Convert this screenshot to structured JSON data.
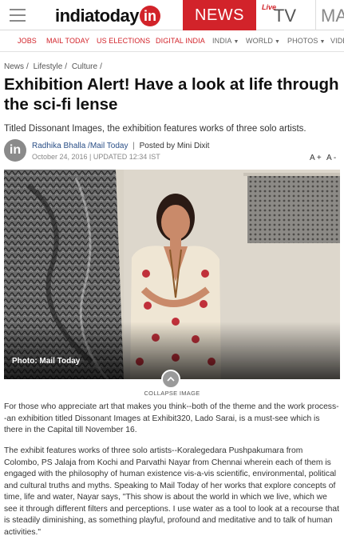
{
  "header": {
    "logo_text": "indiatoday",
    "logo_badge": "in",
    "news_tab": "NEWS",
    "tv_live": "Live",
    "tv_tab": "TV",
    "ma_tab": "MA"
  },
  "subnav": [
    {
      "label": "JOBS"
    },
    {
      "label": "MAIL TODAY"
    },
    {
      "label": "US ELECTIONS"
    },
    {
      "label": "DIGITAL INDIA"
    },
    {
      "label": "INDIA"
    },
    {
      "label": "WORLD"
    },
    {
      "label": "PHOTOS"
    },
    {
      "label": "VIDE"
    }
  ],
  "breadcrumb": [
    "News",
    "Lifestyle",
    "Culture"
  ],
  "article": {
    "headline": "Exhibition Alert! Have a look at life through the sci-fi lense",
    "subhead": "Titled Dissonant Images, the exhibition features works of three solo artists.",
    "avatar": "in",
    "author": "Radhika Bhalla",
    "outlet": "/Mail Today",
    "posted_by": "Posted by Mini Dixit",
    "date": "October 24, 2016 | UPDATED 12:34 IST",
    "font_up": "A +",
    "font_down": "A -",
    "photo_caption": "Photo: Mail Today",
    "collapse_label": "COLLAPSE IMAGE",
    "paragraph_1": "For those who appreciate art that makes you think--both of the theme and the work process--an exhibition titled Dissonant Images at Exhibit320, Lado Sarai, is a must-see which is there in the Capital till November 16.",
    "paragraph_2": "The exhibit features works of three solo artists--Koralegedara Pushpakumara from Colombo, PS Jalaja from Kochi and Parvathi Nayar from Chennai wherein each of them is engaged with the philosophy of human existence vis-a-vis scientific, environmental, political and cultural truths and myths. Speaking to Mail Today of her works that explore concepts of time, life and water, Nayar says, \"This show is about the world in which we live, which we see it through different filters and perceptions. I use water as a tool to look at a recourse that is steadily diminishing, as something playful, profound and meditative and to talk of human activities.\""
  },
  "colors": {
    "brand_red": "#d2232a",
    "author_blue": "#2a4f87"
  }
}
